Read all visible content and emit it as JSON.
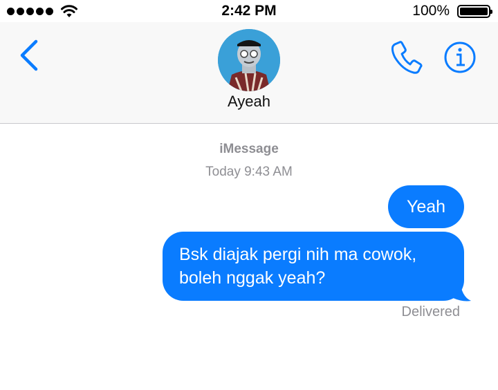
{
  "status_bar": {
    "time": "2:42 PM",
    "battery_percent": "100%",
    "signal_bars": 5,
    "battery_level": 1.0
  },
  "header": {
    "contact_name": "Ayeah",
    "back_icon": "chevron-left-icon",
    "call_icon": "phone-icon",
    "info_icon": "info-icon"
  },
  "conversation": {
    "service": "iMessage",
    "timestamp": "Today 9:43 AM",
    "messages": [
      {
        "text": "Yeah",
        "sender": "me"
      },
      {
        "text": "Bsk diajak pergi nih ma cowok, boleh nggak yeah?",
        "sender": "me"
      }
    ],
    "delivery_status": "Delivered"
  },
  "colors": {
    "accent": "#0a7cff",
    "bubble_text": "#ffffff",
    "secondary_text": "#8e8e93",
    "header_bg": "#f8f8f8"
  }
}
